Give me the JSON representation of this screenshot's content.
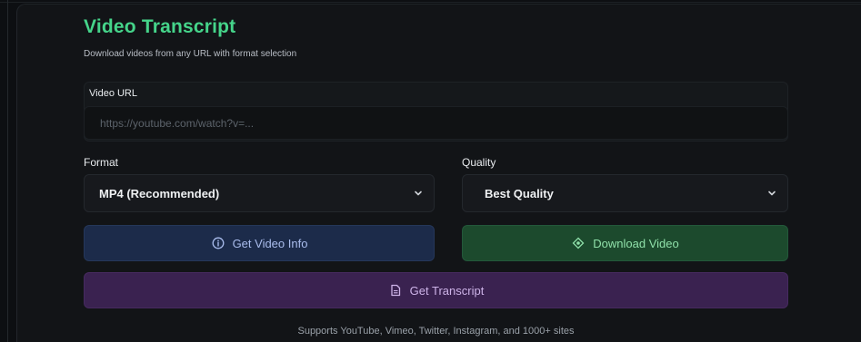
{
  "header": {
    "title": "Video Transcript",
    "subtitle": "Download videos from any URL with format selection"
  },
  "url": {
    "label": "Video URL",
    "placeholder": "https://youtube.com/watch?v=...",
    "value": ""
  },
  "format": {
    "label": "Format",
    "selected": "MP4 (Recommended)"
  },
  "quality": {
    "label": "Quality",
    "selected": "Best Quality"
  },
  "buttons": {
    "info_label": "Get Video Info",
    "download_label": "Download Video",
    "transcript_label": "Get Transcript"
  },
  "footer": {
    "text": "Supports YouTube, Vimeo, Twitter, Instagram, and 1000+ sites"
  },
  "colors": {
    "accent_green": "#45d48a",
    "info_button": "#1c2b4a",
    "download_button": "#1c4a2d",
    "transcript_button": "#3a2250"
  },
  "icons": {
    "info": "info-circle-icon",
    "download": "download-icon",
    "transcript": "document-icon",
    "chevron": "chevron-down-icon"
  }
}
